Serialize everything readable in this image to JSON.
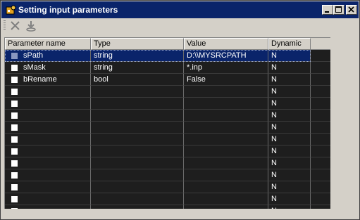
{
  "window": {
    "title": "Setting input parameters"
  },
  "toolbar": {
    "tools": [
      {
        "icon": "delete-x-icon"
      },
      {
        "icon": "insert-parameter-icon"
      }
    ]
  },
  "table": {
    "columns": [
      "Parameter name",
      "Type",
      "Value",
      "Dynamic"
    ],
    "rows": [
      {
        "name": "sPath",
        "type": "string",
        "value": "D:\\\\MYSRCPATH",
        "dynamic": "N",
        "selected": true
      },
      {
        "name": "sMask",
        "type": "string",
        "value": "*.inp",
        "dynamic": "N"
      },
      {
        "name": "bRename",
        "type": "bool",
        "value": "False",
        "dynamic": "N"
      },
      {
        "name": "",
        "type": "",
        "value": "",
        "dynamic": "N"
      },
      {
        "name": "",
        "type": "",
        "value": "",
        "dynamic": "N"
      },
      {
        "name": "",
        "type": "",
        "value": "",
        "dynamic": "N"
      },
      {
        "name": "",
        "type": "",
        "value": "",
        "dynamic": "N"
      },
      {
        "name": "",
        "type": "",
        "value": "",
        "dynamic": "N"
      },
      {
        "name": "",
        "type": "",
        "value": "",
        "dynamic": "N"
      },
      {
        "name": "",
        "type": "",
        "value": "",
        "dynamic": "N"
      },
      {
        "name": "",
        "type": "",
        "value": "",
        "dynamic": "N"
      },
      {
        "name": "",
        "type": "",
        "value": "",
        "dynamic": "N"
      },
      {
        "name": "",
        "type": "",
        "value": "",
        "dynamic": "N"
      },
      {
        "name": "",
        "type": "",
        "value": "",
        "dynamic": "N"
      }
    ]
  },
  "colors": {
    "titlebar": "#0a246a",
    "grid_bg": "#1e1e1e",
    "selection": "#0a246a"
  }
}
